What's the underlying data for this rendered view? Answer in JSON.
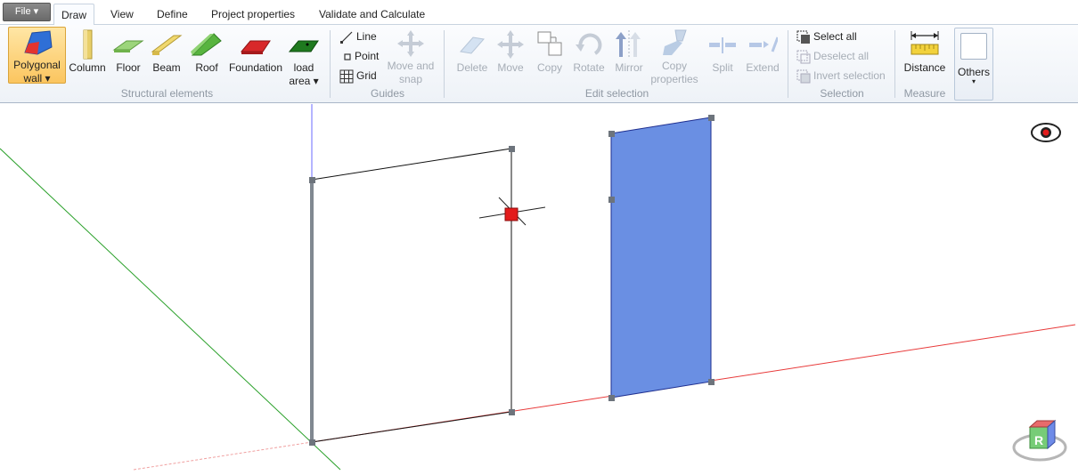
{
  "file_menu": {
    "label": "File ▾"
  },
  "tabs": [
    {
      "label": "Draw",
      "active": true
    },
    {
      "label": "View"
    },
    {
      "label": "Define"
    },
    {
      "label": "Project properties"
    },
    {
      "label": "Validate and Calculate"
    }
  ],
  "ribbon": {
    "structural": {
      "group_label": "Structural elements",
      "polygonal_wall": {
        "line1": "Polygonal",
        "line2": "wall ▾"
      },
      "column": "Column",
      "floor": "Floor",
      "beam": "Beam",
      "roof": "Roof",
      "foundation": "Foundation",
      "load_area": {
        "line1": "load",
        "line2": "area ▾"
      }
    },
    "guides": {
      "group_label": "Guides",
      "line": "Line",
      "point": "Point",
      "grid": "Grid",
      "move_and_snap": {
        "line1": "Move and",
        "line2": "snap"
      }
    },
    "edit_selection": {
      "group_label": "Edit selection",
      "delete": "Delete",
      "move": "Move",
      "copy": "Copy",
      "rotate": "Rotate",
      "mirror": "Mirror",
      "copy_properties": {
        "line1": "Copy",
        "line2": "properties"
      },
      "split": "Split",
      "extend": "Extend"
    },
    "selection": {
      "group_label": "Selection",
      "select_all": "Select all",
      "deselect_all": "Deselect all",
      "invert_selection": "Invert selection"
    },
    "measure": {
      "group_label": "Measure",
      "distance": "Distance"
    },
    "others": {
      "label": "Others",
      "arrow": "▾"
    }
  },
  "viewport": {
    "nav_cube_label": "R",
    "colors": {
      "x_axis": "#e83a3a",
      "y_axis": "#2aa02a",
      "z_axis": "#6a6aff",
      "selected_wall_fill": "#6a8fe3",
      "cursor": "#e31b1b"
    }
  }
}
